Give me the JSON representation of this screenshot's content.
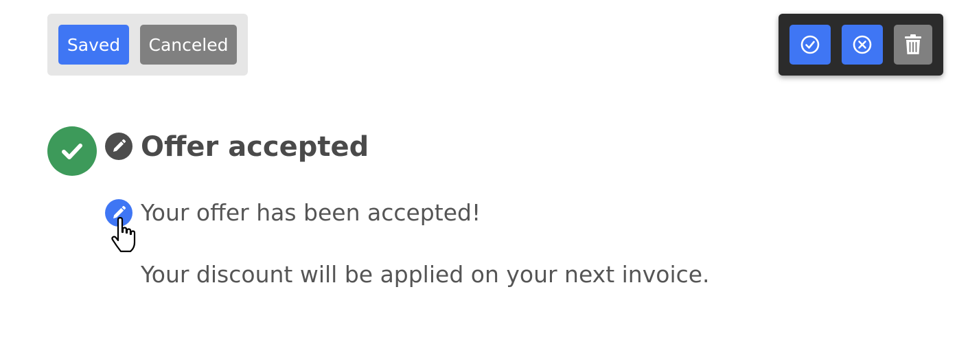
{
  "status_group": {
    "saved_label": "Saved",
    "canceled_label": "Canceled"
  },
  "toolbar": {
    "confirm_icon": "check-circle-icon",
    "cancel_icon": "x-circle-icon",
    "delete_icon": "trash-icon"
  },
  "content": {
    "badge_icon": "checkmark-icon",
    "title": "Offer accepted",
    "message_line_1": "Your offer has been accepted!",
    "message_line_2": "Your discount will be applied on your next invoice."
  },
  "colors": {
    "primary": "#3f76f4",
    "neutral": "#808080",
    "success": "#3d9a5a",
    "toolbar_bg": "#2b2b2b",
    "text": "#4a4a4a"
  }
}
